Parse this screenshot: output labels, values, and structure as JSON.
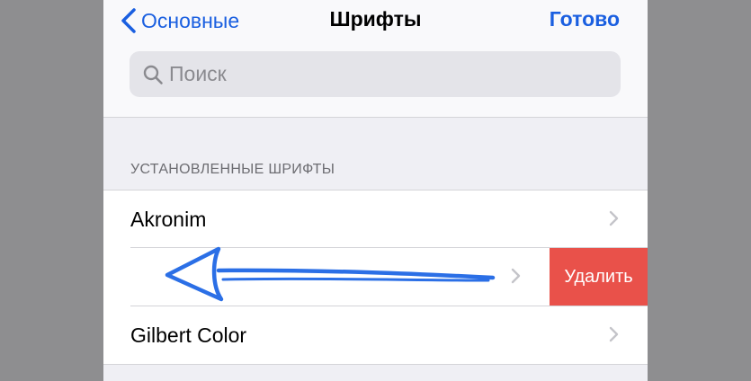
{
  "navbar": {
    "back_label": "Основные",
    "title": "Шрифты",
    "done_label": "Готово"
  },
  "search": {
    "placeholder": "Поиск"
  },
  "section": {
    "header": "УСТАНОВЛЕННЫЕ ШРИФТЫ"
  },
  "fonts": {
    "items": [
      {
        "label": "Akronim"
      },
      {
        "label": ""
      },
      {
        "label": "Gilbert Color"
      }
    ],
    "delete_label": "Удалить"
  },
  "colors": {
    "accent": "#1a5fe0",
    "destructive": "#e9514a",
    "annotation_arrow": "#2b6fe6"
  },
  "icons": {
    "back": "chevron-left-icon",
    "search": "magnifier-icon",
    "row": "chevron-right-icon"
  }
}
